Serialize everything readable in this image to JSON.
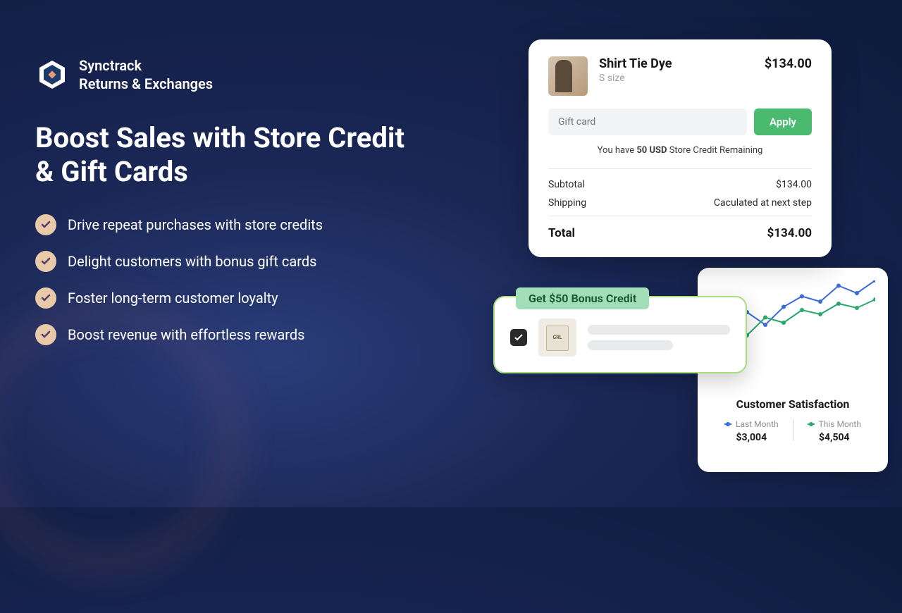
{
  "brand": {
    "line1": "Synctrack",
    "line2": "Returns & Exchanges"
  },
  "headline": "Boost Sales with Store Credit & Gift Cards",
  "bullets": [
    "Drive repeat purchases with store credits",
    "Delight customers with bonus gift cards",
    "Foster long-term customer loyalty",
    "Boost revenue with effortless rewards"
  ],
  "checkout": {
    "product_name": "Shirt Tie Dye",
    "product_variant": "S size",
    "product_price": "$134.00",
    "giftcard_placeholder": "Gift card",
    "apply_label": "Apply",
    "credit_pre": "You have ",
    "credit_amount": "50 USD",
    "credit_post": " Store Credit Remaining",
    "subtotal_label": "Subtotal",
    "subtotal_value": "$134.00",
    "shipping_label": "Shipping",
    "shipping_value": "Caculated at next step",
    "total_label": "Total",
    "total_value": "$134.00"
  },
  "bonus": {
    "badge": "Get $50 Bonus Credit"
  },
  "satisfaction": {
    "title": "Customer Satisfaction",
    "last_label": "Last Month",
    "last_value": "$3,004",
    "this_label": "This Month",
    "this_value": "$4,504"
  },
  "chart_data": {
    "type": "line",
    "title": "Customer Satisfaction",
    "series": [
      {
        "name": "Last Month",
        "color": "#3a6bd8",
        "values": [
          60,
          55,
          70,
          58,
          75,
          85,
          80,
          95,
          88,
          100
        ]
      },
      {
        "name": "This Month",
        "color": "#2aa86b",
        "values": [
          50,
          62,
          48,
          65,
          60,
          72,
          68,
          78,
          74,
          82
        ]
      }
    ]
  }
}
